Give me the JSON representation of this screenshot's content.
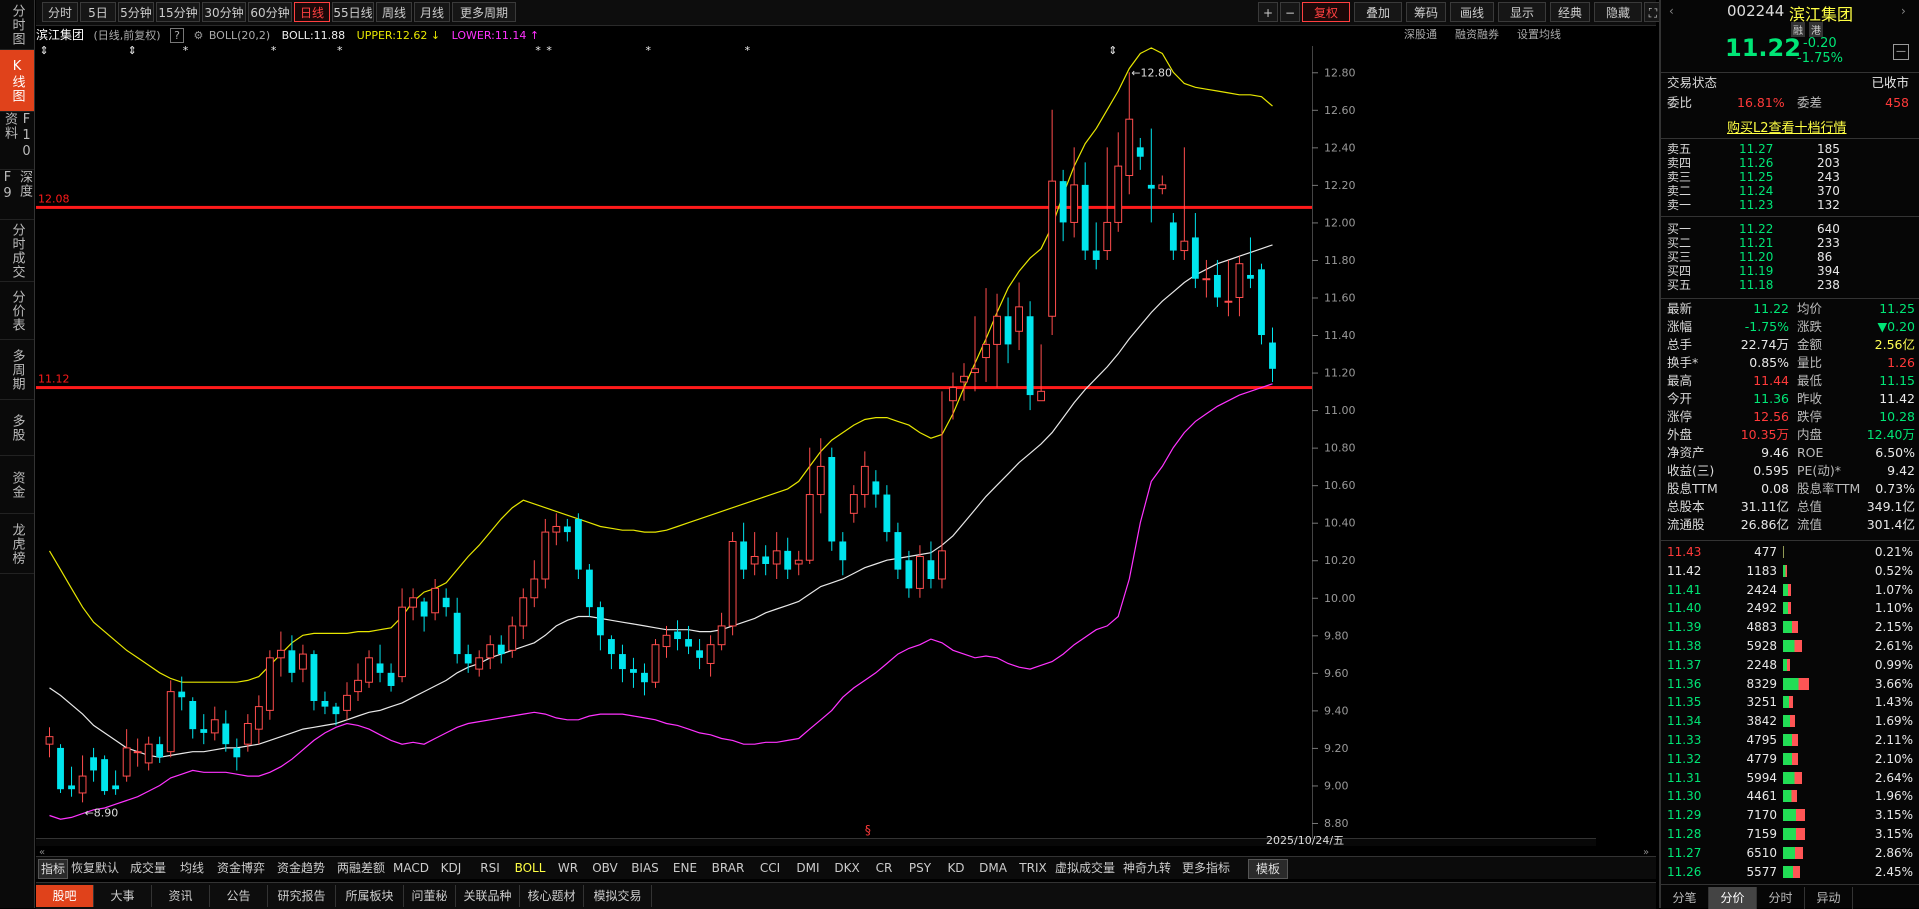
{
  "toolbar": {
    "periods": [
      "分时",
      "5日",
      "5分钟",
      "15分钟",
      "30分钟",
      "60分钟",
      "日线",
      "55日线",
      "周线",
      "月线",
      "更多周期"
    ],
    "active_period": "日线",
    "right_buttons": [
      "+",
      "−",
      "复权",
      "叠加",
      "筹码",
      "画线",
      "显示",
      "经典",
      "隐藏"
    ]
  },
  "left_tabs": [
    "分时图",
    "K线图",
    "F10资料",
    "深度F9",
    "分时成交",
    "分价表",
    "多周期",
    "多股",
    "资金",
    "龙虎榜"
  ],
  "infobar": {
    "stock_name": "滨江集团",
    "desc": "(日线,前复权)",
    "help": "?",
    "indicator": "BOLL(20,2)",
    "boll": "BOLL:11.88",
    "upper": "UPPER:12.62",
    "lower": "LOWER:11.14",
    "links": [
      "深股通",
      "融资融券",
      "设置均线"
    ]
  },
  "chart_data": {
    "type": "candlestick",
    "y_ticks": [
      "12.80",
      "12.60",
      "12.40",
      "12.20",
      "12.00",
      "11.80",
      "11.60",
      "11.40",
      "11.20",
      "11.00",
      "10.80",
      "10.60",
      "10.40",
      "10.20",
      "10.00",
      "9.80",
      "9.60",
      "9.40",
      "9.20",
      "9.00",
      "8.80"
    ],
    "ylim": [
      8.72,
      12.94
    ],
    "hlines": [
      {
        "value": 12.08,
        "label": "12.08"
      },
      {
        "value": 11.12,
        "label": "11.12"
      }
    ],
    "high_label": "12.80",
    "low_label": "8.90",
    "date_label": "2025/10/24/五",
    "candles": [
      [
        9.22,
        9.26,
        9.15,
        9.31
      ],
      [
        9.2,
        8.98,
        8.96,
        9.22
      ],
      [
        9.0,
        8.98,
        8.94,
        9.1
      ],
      [
        8.96,
        9.05,
        8.91,
        9.16
      ],
      [
        9.15,
        9.08,
        9.02,
        9.2
      ],
      [
        9.14,
        8.97,
        8.95,
        9.16
      ],
      [
        9.0,
        8.98,
        8.95,
        9.08
      ],
      [
        9.05,
        9.2,
        9.02,
        9.3
      ],
      [
        9.18,
        9.18,
        9.1,
        9.25
      ],
      [
        9.12,
        9.22,
        9.08,
        9.26
      ],
      [
        9.22,
        9.15,
        9.12,
        9.26
      ],
      [
        9.18,
        9.5,
        9.15,
        9.56
      ],
      [
        9.5,
        9.47,
        9.4,
        9.58
      ],
      [
        9.45,
        9.3,
        9.25,
        9.47
      ],
      [
        9.3,
        9.28,
        9.22,
        9.38
      ],
      [
        9.28,
        9.35,
        9.24,
        9.42
      ],
      [
        9.33,
        9.22,
        9.18,
        9.4
      ],
      [
        9.2,
        9.15,
        9.08,
        9.25
      ],
      [
        9.22,
        9.33,
        9.18,
        9.38
      ],
      [
        9.3,
        9.42,
        9.22,
        9.48
      ],
      [
        9.4,
        9.68,
        9.35,
        9.72
      ],
      [
        9.68,
        9.72,
        9.58,
        9.82
      ],
      [
        9.72,
        9.6,
        9.55,
        9.8
      ],
      [
        9.62,
        9.7,
        9.55,
        9.75
      ],
      [
        9.7,
        9.45,
        9.4,
        9.72
      ],
      [
        9.45,
        9.42,
        9.38,
        9.5
      ],
      [
        9.42,
        9.38,
        9.32,
        9.44
      ],
      [
        9.4,
        9.48,
        9.35,
        9.55
      ],
      [
        9.5,
        9.56,
        9.45,
        9.65
      ],
      [
        9.55,
        9.68,
        9.52,
        9.72
      ],
      [
        9.65,
        9.6,
        9.55,
        9.75
      ],
      [
        9.6,
        9.53,
        9.5,
        9.65
      ],
      [
        9.58,
        9.95,
        9.55,
        10.05
      ],
      [
        9.95,
        10.0,
        9.88,
        10.05
      ],
      [
        9.98,
        9.9,
        9.82,
        10.0
      ],
      [
        9.92,
        10.05,
        9.88,
        10.1
      ],
      [
        10.0,
        9.95,
        9.9,
        10.05
      ],
      [
        9.92,
        9.7,
        9.65,
        10.0
      ],
      [
        9.7,
        9.65,
        9.6,
        9.75
      ],
      [
        9.62,
        9.68,
        9.58,
        9.72
      ],
      [
        9.68,
        9.75,
        9.62,
        9.8
      ],
      [
        9.75,
        9.7,
        9.65,
        9.8
      ],
      [
        9.72,
        9.85,
        9.68,
        9.9
      ],
      [
        9.85,
        10.0,
        9.78,
        10.05
      ],
      [
        10.0,
        10.1,
        9.95,
        10.2
      ],
      [
        10.1,
        10.35,
        10.05,
        10.42
      ],
      [
        10.35,
        10.38,
        10.28,
        10.45
      ],
      [
        10.38,
        10.35,
        10.3,
        10.42
      ],
      [
        10.42,
        10.15,
        10.1,
        10.45
      ],
      [
        10.15,
        9.95,
        9.9,
        10.18
      ],
      [
        9.95,
        9.8,
        9.72,
        9.98
      ],
      [
        9.78,
        9.7,
        9.62,
        9.8
      ],
      [
        9.7,
        9.62,
        9.55,
        9.75
      ],
      [
        9.62,
        9.6,
        9.52,
        9.68
      ],
      [
        9.6,
        9.55,
        9.48,
        9.65
      ],
      [
        9.55,
        9.75,
        9.52,
        9.78
      ],
      [
        9.74,
        9.8,
        9.68,
        9.85
      ],
      [
        9.82,
        9.78,
        9.72,
        9.88
      ],
      [
        9.78,
        9.74,
        9.7,
        9.85
      ],
      [
        9.72,
        9.68,
        9.62,
        9.78
      ],
      [
        9.65,
        9.75,
        9.58,
        9.8
      ],
      [
        9.75,
        9.85,
        9.72,
        9.92
      ],
      [
        9.85,
        10.3,
        9.8,
        10.35
      ],
      [
        10.3,
        10.15,
        10.1,
        10.4
      ],
      [
        10.18,
        10.22,
        10.12,
        10.35
      ],
      [
        10.22,
        10.18,
        10.12,
        10.28
      ],
      [
        10.18,
        10.25,
        10.1,
        10.35
      ],
      [
        10.25,
        10.15,
        10.1,
        10.32
      ],
      [
        10.18,
        10.2,
        10.12,
        10.25
      ],
      [
        10.2,
        10.55,
        10.18,
        10.8
      ],
      [
        10.55,
        10.7,
        10.45,
        10.85
      ],
      [
        10.75,
        10.3,
        10.25,
        10.8
      ],
      [
        10.3,
        10.2,
        10.12,
        10.35
      ],
      [
        10.45,
        10.55,
        10.4,
        10.6
      ],
      [
        10.55,
        10.7,
        10.48,
        10.78
      ],
      [
        10.62,
        10.55,
        10.48,
        10.68
      ],
      [
        10.55,
        10.35,
        10.3,
        10.6
      ],
      [
        10.35,
        10.15,
        10.1,
        10.4
      ],
      [
        10.2,
        10.05,
        10.0,
        10.25
      ],
      [
        10.05,
        10.22,
        10.0,
        10.28
      ],
      [
        10.2,
        10.1,
        10.05,
        10.3
      ],
      [
        10.1,
        10.25,
        10.05,
        11.1
      ],
      [
        11.05,
        11.12,
        10.95,
        11.2
      ],
      [
        11.15,
        11.18,
        11.05,
        11.25
      ],
      [
        11.2,
        11.22,
        11.1,
        11.5
      ],
      [
        11.28,
        11.35,
        11.15,
        11.65
      ],
      [
        11.35,
        11.5,
        11.12,
        11.62
      ],
      [
        11.5,
        11.35,
        11.25,
        11.6
      ],
      [
        11.42,
        11.55,
        11.32,
        11.68
      ],
      [
        11.5,
        11.08,
        11.0,
        11.58
      ],
      [
        11.05,
        11.1,
        11.05,
        11.35
      ],
      [
        11.5,
        12.22,
        11.4,
        12.6
      ],
      [
        12.22,
        12.0,
        11.9,
        12.28
      ],
      [
        12.0,
        12.2,
        11.92,
        12.4
      ],
      [
        12.2,
        11.85,
        11.8,
        12.32
      ],
      [
        11.85,
        11.8,
        11.75,
        12.0
      ],
      [
        11.85,
        12.0,
        11.8,
        12.4
      ],
      [
        12.0,
        12.3,
        11.95,
        12.48
      ],
      [
        12.25,
        12.55,
        12.15,
        12.8
      ],
      [
        12.4,
        12.35,
        12.28,
        12.45
      ],
      [
        12.2,
        12.18,
        12.0,
        12.5
      ],
      [
        12.18,
        12.2,
        12.15,
        12.25
      ],
      [
        12.0,
        11.85,
        11.8,
        12.05
      ],
      [
        11.85,
        11.9,
        11.8,
        12.4
      ],
      [
        11.92,
        11.7,
        11.65,
        12.05
      ],
      [
        11.7,
        11.7,
        11.6,
        11.8
      ],
      [
        11.72,
        11.6,
        11.55,
        11.8
      ],
      [
        11.58,
        11.58,
        11.5,
        11.8
      ],
      [
        11.6,
        11.78,
        11.5,
        11.82
      ],
      [
        11.72,
        11.7,
        11.65,
        11.92
      ],
      [
        11.75,
        11.4,
        11.35,
        11.78
      ],
      [
        11.36,
        11.22,
        11.15,
        11.44
      ]
    ],
    "mid": [
      9.52,
      9.48,
      9.43,
      9.38,
      9.32,
      9.28,
      9.24,
      9.2,
      9.18,
      9.16,
      9.15,
      9.16,
      9.17,
      9.18,
      9.18,
      9.19,
      9.2,
      9.2,
      9.21,
      9.22,
      9.24,
      9.26,
      9.28,
      9.3,
      9.31,
      9.32,
      9.33,
      9.35,
      9.37,
      9.39,
      9.4,
      9.42,
      9.44,
      9.47,
      9.5,
      9.53,
      9.56,
      9.6,
      9.63,
      9.65,
      9.68,
      9.7,
      9.72,
      9.74,
      9.76,
      9.8,
      9.85,
      9.88,
      9.9,
      9.9,
      9.89,
      9.88,
      9.87,
      9.86,
      9.85,
      9.84,
      9.83,
      9.83,
      9.83,
      9.82,
      9.82,
      9.83,
      9.85,
      9.87,
      9.89,
      9.92,
      9.94,
      9.96,
      9.98,
      10.02,
      10.06,
      10.08,
      10.1,
      10.13,
      10.16,
      10.18,
      10.2,
      10.21,
      10.22,
      10.23,
      10.24,
      10.28,
      10.33,
      10.4,
      10.47,
      10.54,
      10.6,
      10.66,
      10.72,
      10.77,
      10.82,
      10.88,
      10.96,
      11.04,
      11.11,
      11.17,
      11.23,
      11.3,
      11.38,
      11.45,
      11.52,
      11.58,
      11.63,
      11.68,
      11.72,
      11.75,
      11.78,
      11.8,
      11.82,
      11.84,
      11.86,
      11.88
    ],
    "upper": [
      10.25,
      10.15,
      10.05,
      9.95,
      9.87,
      9.82,
      9.77,
      9.72,
      9.68,
      9.64,
      9.6,
      9.57,
      9.55,
      9.55,
      9.55,
      9.55,
      9.55,
      9.55,
      9.56,
      9.58,
      9.64,
      9.7,
      9.76,
      9.8,
      9.81,
      9.81,
      9.81,
      9.81,
      9.82,
      9.82,
      9.83,
      9.84,
      9.9,
      9.98,
      10.03,
      10.05,
      10.08,
      10.15,
      10.22,
      10.28,
      10.35,
      10.42,
      10.48,
      10.52,
      10.5,
      10.48,
      10.46,
      10.44,
      10.42,
      10.4,
      10.38,
      10.37,
      10.36,
      10.36,
      10.35,
      10.35,
      10.36,
      10.38,
      10.4,
      10.42,
      10.44,
      10.46,
      10.48,
      10.5,
      10.52,
      10.54,
      10.56,
      10.58,
      10.62,
      10.7,
      10.78,
      10.84,
      10.88,
      10.92,
      10.95,
      10.96,
      10.96,
      10.94,
      10.92,
      10.88,
      10.85,
      10.87,
      10.98,
      11.12,
      11.25,
      11.38,
      11.52,
      11.65,
      11.74,
      11.81,
      11.86,
      11.98,
      12.15,
      12.3,
      12.42,
      12.5,
      12.6,
      12.7,
      12.82,
      12.9,
      12.93,
      12.9,
      12.8,
      12.74,
      12.72,
      12.71,
      12.7,
      12.69,
      12.68,
      12.68,
      12.67,
      12.62
    ],
    "lower": [
      8.84,
      8.82,
      8.83,
      8.85,
      8.87,
      8.88,
      8.9,
      8.92,
      8.94,
      8.97,
      9.0,
      9.04,
      9.06,
      9.08,
      9.07,
      9.07,
      9.07,
      9.06,
      9.05,
      9.05,
      9.07,
      9.1,
      9.14,
      9.19,
      9.24,
      9.28,
      9.31,
      9.33,
      9.32,
      9.3,
      9.27,
      9.24,
      9.22,
      9.23,
      9.22,
      9.25,
      9.28,
      9.31,
      9.33,
      9.34,
      9.35,
      9.36,
      9.37,
      9.38,
      9.39,
      9.38,
      9.36,
      9.35,
      9.35,
      9.37,
      9.38,
      9.38,
      9.38,
      9.37,
      9.36,
      9.35,
      9.33,
      9.32,
      9.3,
      9.28,
      9.27,
      9.25,
      9.24,
      9.22,
      9.22,
      9.23,
      9.23,
      9.24,
      9.25,
      9.3,
      9.35,
      9.4,
      9.47,
      9.52,
      9.56,
      9.6,
      9.65,
      9.7,
      9.73,
      9.75,
      9.78,
      9.76,
      9.72,
      9.7,
      9.68,
      9.69,
      9.68,
      9.65,
      9.63,
      9.62,
      9.64,
      9.66,
      9.7,
      9.75,
      9.79,
      9.83,
      9.85,
      9.9,
      10.1,
      10.4,
      10.62,
      10.7,
      10.8,
      10.88,
      10.94,
      10.98,
      11.02,
      11.05,
      11.08,
      11.1,
      11.12,
      11.14
    ]
  },
  "indicators": [
    "指标",
    "恢复默认",
    "成交量",
    "均线",
    "资金博弈",
    "资金趋势",
    "两融差额",
    "MACD",
    "KDJ",
    "RSI",
    "BOLL",
    "WR",
    "OBV",
    "BIAS",
    "ENE",
    "BRAR",
    "CCI",
    "DMI",
    "DKX",
    "CR",
    "PSY",
    "KD",
    "DMA",
    "TRIX",
    "虚拟成交量",
    "神奇九转",
    "更多指标",
    "模板"
  ],
  "bottom_tabs": [
    "股吧",
    "大事",
    "资讯",
    "公告",
    "研究报告",
    "所属板块",
    "问董秘",
    "关联品种",
    "核心题材",
    "模拟交易"
  ],
  "quote": {
    "code": "002244",
    "name": "滨江集团",
    "price": "11.22",
    "change": "-0.20",
    "pct": "-1.75%",
    "tags": [
      "融",
      "港"
    ],
    "status_label": "交易状态",
    "status": "已收市",
    "weibi_label": "委比",
    "weibi": "16.81%",
    "weicha_label": "委差",
    "weicha": "458",
    "l2_link": "购买L2查看十档行情",
    "sells": [
      [
        "卖五",
        "11.27",
        "185"
      ],
      [
        "卖四",
        "11.26",
        "203"
      ],
      [
        "卖三",
        "11.25",
        "243"
      ],
      [
        "卖二",
        "11.24",
        "370"
      ],
      [
        "卖一",
        "11.23",
        "132"
      ]
    ],
    "buys": [
      [
        "买一",
        "11.22",
        "640"
      ],
      [
        "买二",
        "11.21",
        "233"
      ],
      [
        "买三",
        "11.20",
        "86"
      ],
      [
        "买四",
        "11.19",
        "394"
      ],
      [
        "买五",
        "11.18",
        "238"
      ]
    ],
    "stats": [
      [
        "最新",
        "11.22",
        "g",
        "均价",
        "11.25",
        "g"
      ],
      [
        "涨幅",
        "-1.75%",
        "g",
        "涨跌",
        "▼0.20",
        "g"
      ],
      [
        "总手",
        "22.74万",
        "w",
        "金额",
        "2.56亿",
        "y"
      ],
      [
        "换手*",
        "0.85%",
        "w",
        "量比",
        "1.26",
        "r"
      ],
      [
        "最高",
        "11.44",
        "r",
        "最低",
        "11.15",
        "g"
      ],
      [
        "今开",
        "11.36",
        "g",
        "昨收",
        "11.42",
        "w"
      ],
      [
        "涨停",
        "12.56",
        "r",
        "跌停",
        "10.28",
        "g"
      ],
      [
        "外盘",
        "10.35万",
        "r",
        "内盘",
        "12.40万",
        "g"
      ],
      [
        "净资产",
        "9.46",
        "w",
        "ROE",
        "6.50%",
        "w"
      ],
      [
        "收益(三)",
        "0.595",
        "w",
        "PE(动)*",
        "9.42",
        "w"
      ],
      [
        "股息TTM",
        "0.08",
        "w",
        "股息率TTM",
        "0.73%",
        "w"
      ],
      [
        "总股本",
        "31.11亿",
        "w",
        "总值",
        "349.1亿",
        "w"
      ],
      [
        "流通股",
        "26.86亿",
        "w",
        "流值",
        "301.4亿",
        "w"
      ]
    ],
    "price_dist": [
      [
        "11.43",
        "477",
        "0.21%",
        "r"
      ],
      [
        "11.42",
        "1183",
        "0.52%",
        "w"
      ],
      [
        "11.41",
        "2424",
        "1.07%",
        "g"
      ],
      [
        "11.40",
        "2492",
        "1.10%",
        "g"
      ],
      [
        "11.39",
        "4883",
        "2.15%",
        "g"
      ],
      [
        "11.38",
        "5928",
        "2.61%",
        "g"
      ],
      [
        "11.37",
        "2248",
        "0.99%",
        "g"
      ],
      [
        "11.36",
        "8329",
        "3.66%",
        "g"
      ],
      [
        "11.35",
        "3251",
        "1.43%",
        "g"
      ],
      [
        "11.34",
        "3842",
        "1.69%",
        "g"
      ],
      [
        "11.33",
        "4795",
        "2.11%",
        "g"
      ],
      [
        "11.32",
        "4779",
        "2.10%",
        "g"
      ],
      [
        "11.31",
        "5994",
        "2.64%",
        "g"
      ],
      [
        "11.30",
        "4461",
        "1.96%",
        "g"
      ],
      [
        "11.29",
        "7170",
        "3.15%",
        "g"
      ],
      [
        "11.28",
        "7159",
        "3.15%",
        "g"
      ],
      [
        "11.27",
        "6510",
        "2.86%",
        "g"
      ],
      [
        "11.26",
        "5577",
        "2.45%",
        "g"
      ]
    ],
    "panel_tabs": [
      "分笔",
      "分价",
      "分时",
      "异动"
    ]
  },
  "colors": {
    "up": "#ff4d4d",
    "down": "#00e5ee",
    "mid": "#e8e8e8",
    "upper": "#e6e600",
    "lower": "#ff33ff",
    "hline": "#ff1a1a",
    "accent": "#e0421b"
  }
}
